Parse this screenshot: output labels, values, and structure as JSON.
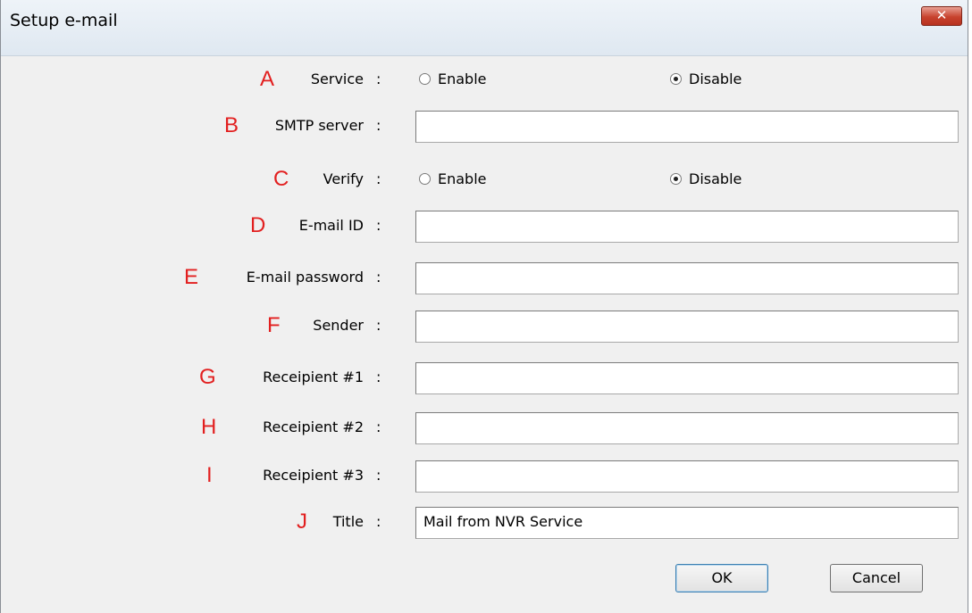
{
  "window": {
    "title": "Setup e-mail",
    "close_glyph": "✕"
  },
  "rows": {
    "service": {
      "letter": "A",
      "label": "Service",
      "enable_label": "Enable",
      "disable_label": "Disable",
      "selected": "Disable"
    },
    "smtp": {
      "letter": "B",
      "label": "SMTP server",
      "value": ""
    },
    "verify": {
      "letter": "C",
      "label": "Verify",
      "enable_label": "Enable",
      "disable_label": "Disable",
      "selected": "Disable"
    },
    "email_id": {
      "letter": "D",
      "label": "E-mail ID",
      "value": ""
    },
    "email_password": {
      "letter": "E",
      "label": "E-mail password",
      "value": ""
    },
    "sender": {
      "letter": "F",
      "label": "Sender",
      "value": ""
    },
    "recipient1": {
      "letter": "G",
      "label": "Receipient #1",
      "value": ""
    },
    "recipient2": {
      "letter": "H",
      "label": "Receipient #2",
      "value": ""
    },
    "recipient3": {
      "letter": "I",
      "label": "Receipient #3",
      "value": ""
    },
    "title": {
      "letter": "J",
      "label": "Title",
      "value": "Mail from NVR Service"
    }
  },
  "colon": ":",
  "buttons": {
    "ok": "OK",
    "cancel": "Cancel"
  },
  "colors": {
    "annotation_letter": "#e21f1f",
    "close_button": "#c7432e"
  }
}
